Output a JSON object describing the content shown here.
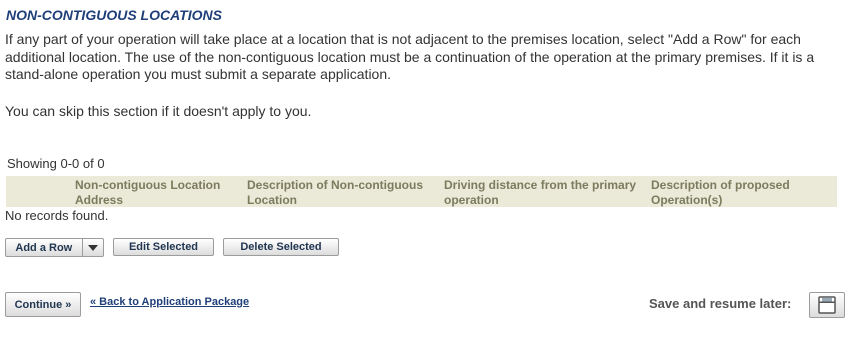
{
  "section": {
    "title": "NON-CONTIGUOUS LOCATIONS",
    "intro": "If any part of your operation will take place at a location that is not adjacent to the premises location, select \"Add a Row\" for each additional location. The use of the non-contiguous location must be a continuation of the operation at the primary premises. If it is a stand-alone operation you must submit a separate application.",
    "skip_note": "You can skip this section if it doesn't apply to you."
  },
  "table": {
    "showing": "Showing 0-0 of 0",
    "columns": [
      {
        "line1": "Non-contiguous Location",
        "line2": "Address"
      },
      {
        "line1": "Description of Non-contiguous",
        "line2": "Location"
      },
      {
        "line1": "Driving distance from the primary",
        "line2": "operation"
      },
      {
        "line1": "Description of proposed",
        "line2": "Operation(s)"
      }
    ],
    "empty_message": "No records found."
  },
  "actions": {
    "add_row": "Add a Row",
    "edit_selected": "Edit Selected",
    "delete_selected": "Delete Selected"
  },
  "footer": {
    "continue": "Continue »",
    "back_link": "« Back to Application Package",
    "save_label": "Save and resume later:"
  },
  "icons": {
    "dropdown": "triangle-down-icon",
    "save": "floppy-disk-icon"
  }
}
